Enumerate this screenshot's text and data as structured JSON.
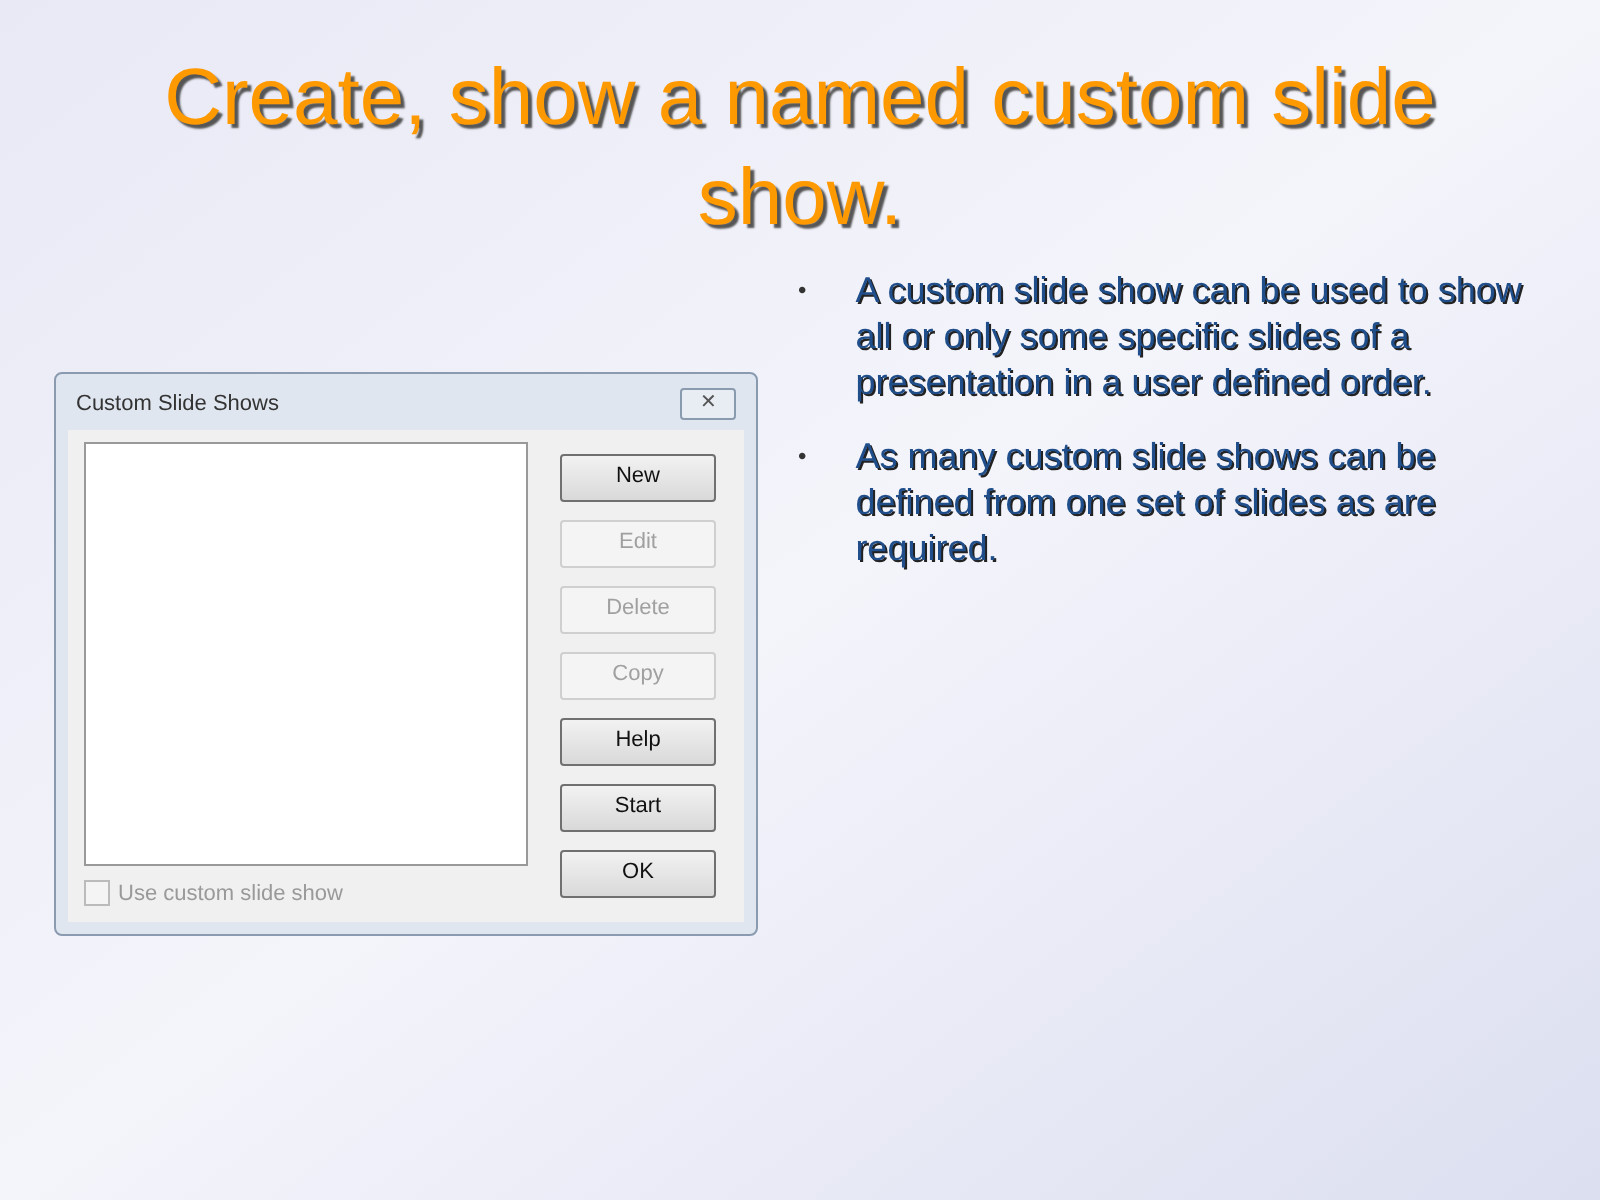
{
  "slide": {
    "title": "Create, show a named custom slide show.",
    "bullets": [
      {
        "bullet": "•",
        "text": "A custom slide show can be used to show all or only some specific slides of a presentation in a user defined order."
      },
      {
        "bullet": "•",
        "text": "As many custom slide shows can be defined from one set of slides as are required."
      }
    ]
  },
  "dialog": {
    "title": "Custom Slide Shows",
    "close": "✕",
    "buttons": [
      {
        "label": "New",
        "disabled": false
      },
      {
        "label": "Edit",
        "disabled": true
      },
      {
        "label": "Delete",
        "disabled": true
      },
      {
        "label": "Copy",
        "disabled": true
      },
      {
        "label": "Help",
        "disabled": false
      },
      {
        "label": "Start",
        "disabled": false
      },
      {
        "label": "OK",
        "disabled": false
      }
    ],
    "checkbox": {
      "label": "Use custom slide show",
      "checked": false,
      "disabled": true
    }
  }
}
